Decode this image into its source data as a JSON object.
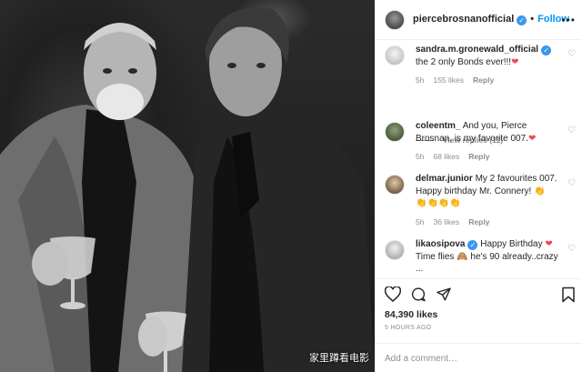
{
  "header": {
    "username": "piercebrosnanofficial",
    "separator": "•",
    "follow_label": "Follow",
    "more_glyph": "•••"
  },
  "comments": [
    {
      "username": "sandra.m.gronewald_official",
      "verified": true,
      "text": "the 2 only Bonds ever!!!",
      "emoji": "❤",
      "age": "5h",
      "likes": "155 likes",
      "reply": "Reply"
    },
    {
      "username": "coleentm_",
      "verified": false,
      "text": "And you, Pierce Brosnan, is my favorite 007.",
      "emoji": "❤",
      "age": "5h",
      "likes": "68 likes",
      "reply": "Reply"
    },
    {
      "username": "delmar.junior",
      "verified": false,
      "text": "My 2 favourites 007. Happy birthday Mr. Connery! 👏",
      "text2": "👏👏👏👏",
      "age": "5h",
      "likes": "36 likes",
      "reply": "Reply"
    },
    {
      "username": "likaosipova",
      "verified": true,
      "text": "Happy Birthday",
      "emoji": "❤",
      "text2": "Time flies 🙈 he's 90 already..crazy ..."
    }
  ],
  "view_replies": "View replies (11)",
  "stats": {
    "likes": "84,390 likes",
    "posted": "5 HOURS AGO"
  },
  "add_comment_placeholder": "Add a comment…",
  "watermark": "家里蹲看电影",
  "icons": {
    "header_avatar": "profile-avatar",
    "verified": "verified-badge-icon",
    "like": "heart-icon",
    "comment": "comment-bubble-icon",
    "share": "paper-plane-icon",
    "save": "bookmark-icon"
  },
  "colors": {
    "accent": "#0095f6",
    "verified": "#3897f0",
    "heart": "#ed4956",
    "muted": "#8e8e8e"
  }
}
